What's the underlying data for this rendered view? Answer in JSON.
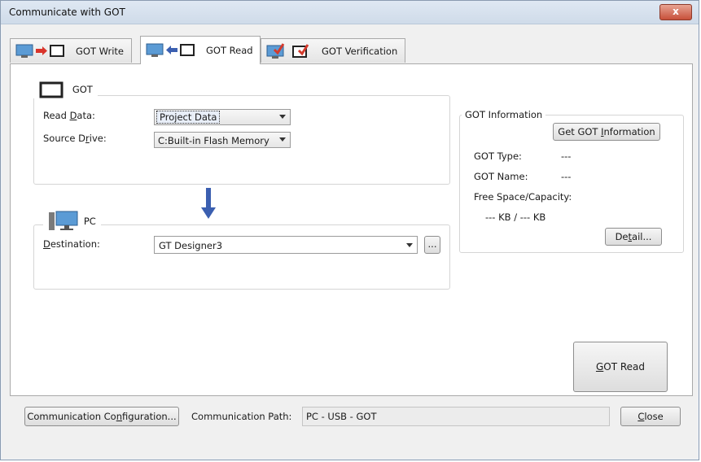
{
  "window": {
    "title": "Communicate with GOT",
    "close_glyph": "x"
  },
  "tabs": [
    {
      "label": "GOT Write",
      "icon": "got-write-icon"
    },
    {
      "label": "GOT Read",
      "icon": "got-read-icon"
    },
    {
      "label": "GOT Verification",
      "icon": "got-verification-icon"
    }
  ],
  "got_group": {
    "title": "GOT",
    "read_data": {
      "label_pre": "Read ",
      "label_u": "D",
      "label_post": "ata:",
      "value": "Project Data"
    },
    "source_drive": {
      "label_pre": "Source D",
      "label_u": "r",
      "label_post": "ive:",
      "value": "C:Built-in Flash Memory"
    }
  },
  "pc_group": {
    "title": "PC",
    "destination": {
      "label_pre": "",
      "label_u": "D",
      "label_post": "estination:",
      "value": "GT Designer3"
    },
    "browse_label": "..."
  },
  "got_info": {
    "title": "GOT Information",
    "get_button": {
      "pre": "Get GOT ",
      "u": "I",
      "post": "nformation"
    },
    "got_type_label": "GOT Type:",
    "got_type_value": "---",
    "got_name_label": "GOT Name:",
    "got_name_value": "---",
    "free_space_label": "Free Space/Capacity:",
    "free_space_value": "--- KB / --- KB",
    "detail_button": {
      "pre": "De",
      "u": "t",
      "post": "ail..."
    }
  },
  "got_read_button": {
    "pre": "",
    "u": "G",
    "post": "OT Read"
  },
  "bottom": {
    "comm_config_button": {
      "pre": "Communication Co",
      "u": "n",
      "post": "figuration..."
    },
    "comm_path_label": "Communication Path:",
    "comm_path_value": "PC - USB - GOT",
    "close_button": {
      "pre": "",
      "u": "C",
      "post": "lose"
    }
  },
  "colors": {
    "arrow_blue": "#3b5fb0",
    "arrow_red": "#d9342b",
    "check_red": "#d33a2c",
    "monitor_blue": "#5b9bd5"
  }
}
